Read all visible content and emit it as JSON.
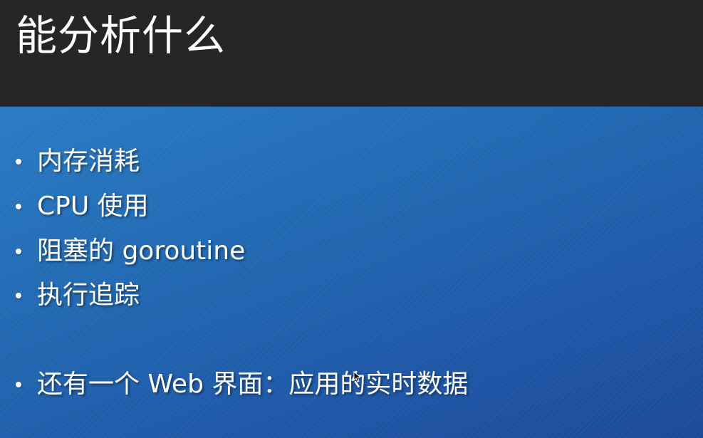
{
  "slide": {
    "title": "能分析什么",
    "bullets": [
      "内存消耗",
      "CPU 使用",
      "阻塞的 goroutine",
      "执行追踪",
      "还有一个 Web 界面：应用的实时数据"
    ]
  },
  "colors": {
    "title_bar": "#262626",
    "content_bg_start": "#2a7cc4",
    "content_bg_end": "#1c4a99",
    "text": "#ffffff"
  },
  "icons": {
    "cursor": "mouse-pointer-icon"
  }
}
